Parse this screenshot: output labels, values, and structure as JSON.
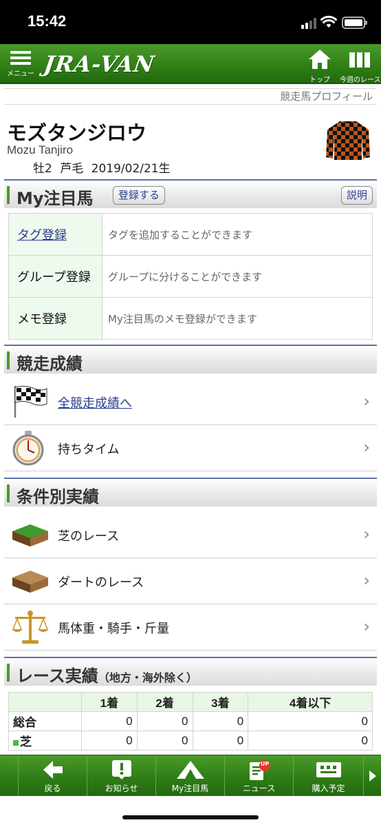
{
  "status_bar": {
    "time": "15:42"
  },
  "header": {
    "menu_label": "メニュー",
    "logo": "JRA-VAN",
    "top_label": "トップ",
    "week_label": "今週のレース"
  },
  "breadcrumb": "競走馬プロフィール",
  "horse": {
    "name": "モズタンジロウ",
    "roman": "Mozu Tanjiro",
    "sex_age": "牡2",
    "color": "芦毛",
    "birth": "2019/02/21生"
  },
  "my_watch": {
    "title": "My注目馬",
    "register_label": "登録する",
    "help_label": "説明",
    "rows": [
      {
        "key": "タグ登録",
        "desc": "タグを追加することができます"
      },
      {
        "key": "グループ登録",
        "desc": "グループに分けることができます"
      },
      {
        "key": "メモ登録",
        "desc": "My注目馬のメモ登録ができます"
      }
    ]
  },
  "race_results": {
    "title": "競走成績",
    "items": [
      {
        "label": "全競走成績へ",
        "icon": "checkered-flag-icon"
      },
      {
        "label": "持ちタイム",
        "icon": "stopwatch-icon"
      }
    ]
  },
  "conditions": {
    "title": "条件別実績",
    "items": [
      {
        "label": "芝のレース",
        "icon": "turf-icon"
      },
      {
        "label": "ダートのレース",
        "icon": "dirt-icon"
      },
      {
        "label": "馬体重・騎手・斤量",
        "icon": "scale-icon"
      }
    ]
  },
  "race_record": {
    "title": "レース実績",
    "subtitle": "（地方・海外除く）",
    "columns": [
      "1着",
      "2着",
      "3着",
      "4着以下"
    ],
    "rows": [
      {
        "label": "総合",
        "values": [
          "0",
          "0",
          "0",
          "0"
        ]
      },
      {
        "label": "芝",
        "values": [
          "0",
          "0",
          "0",
          "0"
        ]
      }
    ]
  },
  "tabbar": {
    "items": [
      {
        "label": "戻る"
      },
      {
        "label": "お知らせ"
      },
      {
        "label": "My注目馬"
      },
      {
        "label": "ニュース",
        "badge": "UP"
      },
      {
        "label": "購入予定"
      }
    ]
  },
  "colors": {
    "brand_green": "#2f7d16",
    "link_blue": "#2a3d8f",
    "table_key_bg": "#eefaee"
  }
}
